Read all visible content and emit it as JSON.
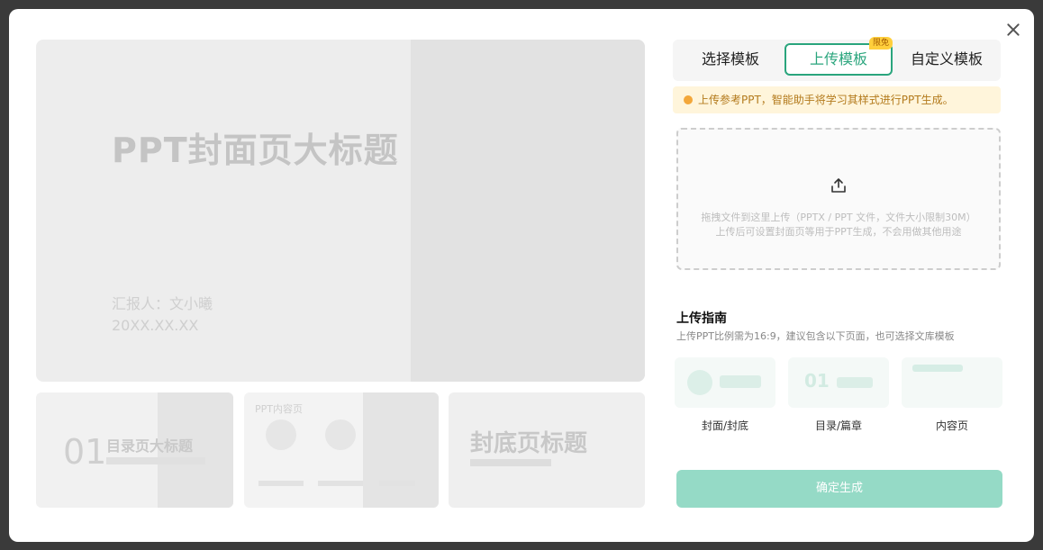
{
  "dialog": {
    "close_label": "×"
  },
  "preview": {
    "cover_title": "PPT封面页大标题",
    "reporter_line1": "汇报人：文小曦",
    "reporter_line2": "20XX.XX.XX",
    "thumb1_number": "01",
    "thumb1_title": "目录页大标题",
    "thumb2_title": "PPT内容页",
    "thumb3_title": "封底页标题"
  },
  "tabs": [
    {
      "label": "选择模板"
    },
    {
      "label": "上传模板",
      "badge": "限免"
    },
    {
      "label": "自定义模板"
    }
  ],
  "notice": {
    "text": "上传参考PPT，智能助手将学习其样式进行PPT生成。"
  },
  "dropzone": {
    "text": "拖拽文件到这里上传（PPTX / PPT 文件，文件大小限制30M）上传后可设置封面页等用于PPT生成，不会用做其他用途"
  },
  "guide": {
    "title": "上传指南",
    "desc": "上传PPT比例需为16:9，建议包含以下页面，也可选择文库模板",
    "cards": [
      {
        "label": "封面/封底"
      },
      {
        "label": "目录/篇章"
      },
      {
        "label": "内容页"
      }
    ]
  },
  "submit": {
    "label": "确定生成"
  },
  "colors": {
    "accent": "#2aa57d",
    "button_disabled": "#95dac6",
    "notice_bg": "#fff5db",
    "notice_text": "#b37a1c"
  }
}
